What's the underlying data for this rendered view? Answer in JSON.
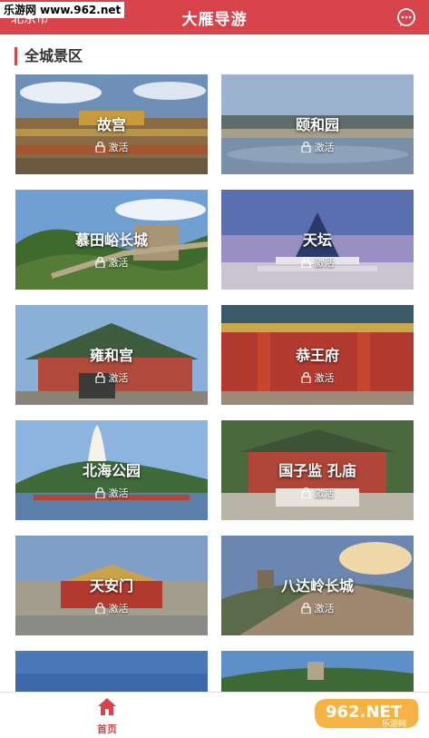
{
  "watermark": "乐游网 www.962.net",
  "header": {
    "city": "北京市",
    "title": "大雁导游"
  },
  "section": {
    "title": "全城景区"
  },
  "scenic_spots": [
    {
      "name": "故宫",
      "status": "激活"
    },
    {
      "name": "颐和园",
      "status": "激活"
    },
    {
      "name": "慕田峪长城",
      "status": "激活"
    },
    {
      "name": "天坛",
      "status": "激活"
    },
    {
      "name": "雍和宫",
      "status": "激活"
    },
    {
      "name": "恭王府",
      "status": "激活"
    },
    {
      "name": "北海公园",
      "status": "激活"
    },
    {
      "name": "国子监 孔庙",
      "status": "激活"
    },
    {
      "name": "天安门",
      "status": "激活"
    },
    {
      "name": "八达岭长城",
      "status": "激活"
    }
  ],
  "bottom_nav": {
    "home_label": "首页"
  },
  "brand_watermark": {
    "big": "962.NET",
    "small": "乐游网"
  },
  "colors": {
    "accent": "#d9434b"
  }
}
